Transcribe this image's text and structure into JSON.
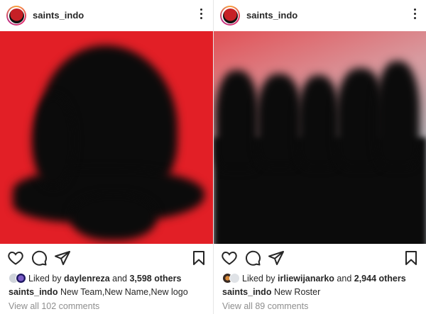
{
  "posts": [
    {
      "username": "saints_indo",
      "liked_prefix": "Liked by ",
      "liked_user": "daylenreza",
      "liked_and": " and ",
      "liked_others": "3,598 others",
      "caption_user": "saints_indo",
      "caption_text": "New Team,New Name,New logo",
      "comments_link": "View all 102 comments"
    },
    {
      "username": "saints_indo",
      "liked_prefix": "Liked by ",
      "liked_user": "irliewijanarko",
      "liked_and": " and ",
      "liked_others": "2,944 others",
      "caption_user": "saints_indo",
      "caption_text": "New Roster",
      "comments_link": "View all 89 comments"
    }
  ],
  "icons": {
    "header_avatar": "avatar-icon",
    "more": "more-options-icon",
    "like": "heart-icon",
    "comment": "comment-bubble-icon",
    "share": "paper-plane-icon",
    "save": "bookmark-icon"
  },
  "colors": {
    "left_image_bg": "#e21f26",
    "text": "#262626",
    "muted": "#8e8e8e"
  }
}
